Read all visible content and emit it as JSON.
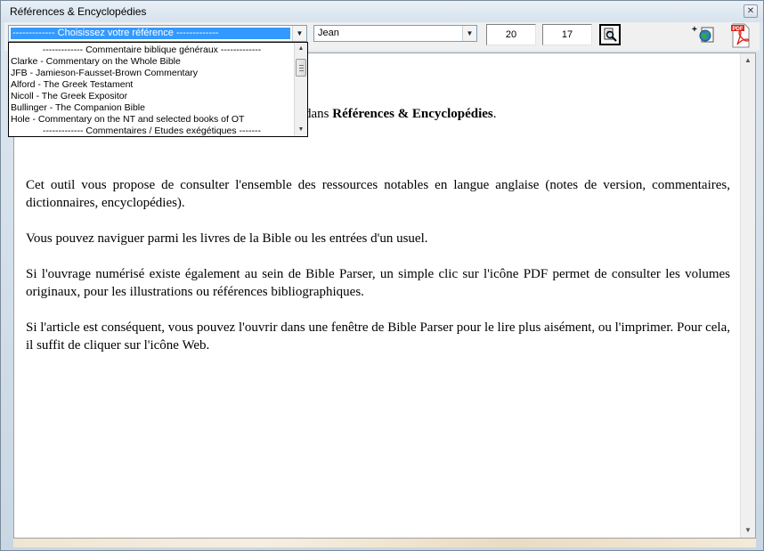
{
  "window": {
    "title": "Références & Encyclopédies",
    "close_glyph": "✕"
  },
  "toolbar": {
    "reference_combo": {
      "selected": "------------- Choisissez votre référence -------------",
      "options": [
        "------------- Commentaire biblique généraux -------------",
        "Clarke - Commentary on the Whole Bible",
        "JFB - Jamieson-Fausset-Brown Commentary",
        "Alford - The Greek Testament",
        "Nicoll - The Greek Expositor",
        "Bullinger - The Companion Bible",
        "Hole - Commentary on the NT and selected books of OT",
        "------------- Commentaires / Etudes exégétiques -------"
      ]
    },
    "book_combo": {
      "selected": "Jean"
    },
    "chapter_value": "20",
    "verse_value": "17",
    "search_icon": "magnifier-icon",
    "web_icon": "web-icon",
    "web_icon_plus": "+",
    "pdf_icon": "pdf-icon",
    "pdf_label": "PDF"
  },
  "content": {
    "welcome_partial": "dans ",
    "welcome_bold": "Références & Encyclopédies",
    "welcome_end": ".",
    "paragraphs": [
      "Cet outil vous propose de consulter l'ensemble des ressources notables en langue anglaise (notes de version, commentaires, dictionnaires, encyclopédies).",
      "Vous pouvez naviguer parmi les livres de la Bible ou les entrées d'un usuel.",
      "Si l'ouvrage numérisé existe également au sein de Bible Parser, un simple clic sur l'icône PDF permet de consulter les volumes originaux, pour les illustrations ou références bibliographiques.",
      "Si l'article est conséquent, vous pouvez l'ouvrir dans une fenêtre de Bible Parser pour le lire plus aisément, ou l'imprimer. Pour cela, il suffit de cliquer sur l'icône Web."
    ]
  },
  "glyphs": {
    "combo_arrow": "▼",
    "scroll_up": "▲",
    "scroll_down": "▼"
  },
  "colors": {
    "selection": "#3399ff",
    "pdf_red": "#d9261c"
  }
}
